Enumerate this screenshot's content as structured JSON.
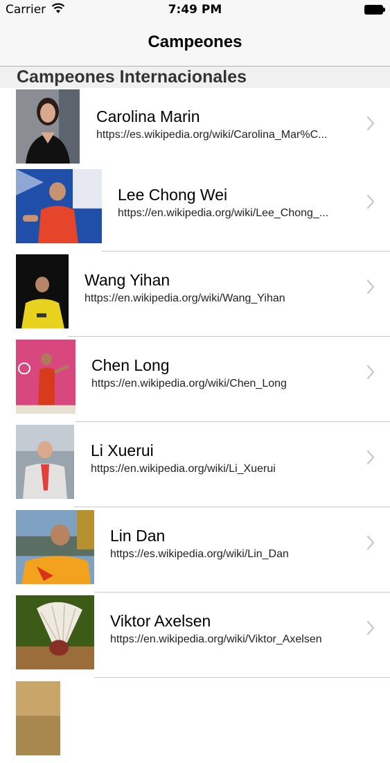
{
  "status_bar": {
    "carrier": "Carrier",
    "time": "7:49 PM"
  },
  "nav": {
    "title": "Campeones"
  },
  "section": {
    "title": "Campeones Internacionales"
  },
  "champions": [
    {
      "name": "Carolina Marin",
      "url": "https://es.wikipedia.org/wiki/Carolina_Mar%C..."
    },
    {
      "name": "Lee Chong Wei",
      "url": "https://en.wikipedia.org/wiki/Lee_Chong_..."
    },
    {
      "name": "Wang Yihan",
      "url": "https://en.wikipedia.org/wiki/Wang_Yihan"
    },
    {
      "name": "Chen Long",
      "url": "https://en.wikipedia.org/wiki/Chen_Long"
    },
    {
      "name": "Li Xuerui",
      "url": "https://en.wikipedia.org/wiki/Li_Xuerui"
    },
    {
      "name": "Lin Dan",
      "url": "https://es.wikipedia.org/wiki/Lin_Dan"
    },
    {
      "name": "Viktor Axelsen",
      "url": "https://en.wikipedia.org/wiki/Viktor_Axelsen"
    }
  ],
  "icons": {
    "wifi": "wifi-icon",
    "battery": "battery-icon",
    "chevron": "chevron-right-icon"
  }
}
